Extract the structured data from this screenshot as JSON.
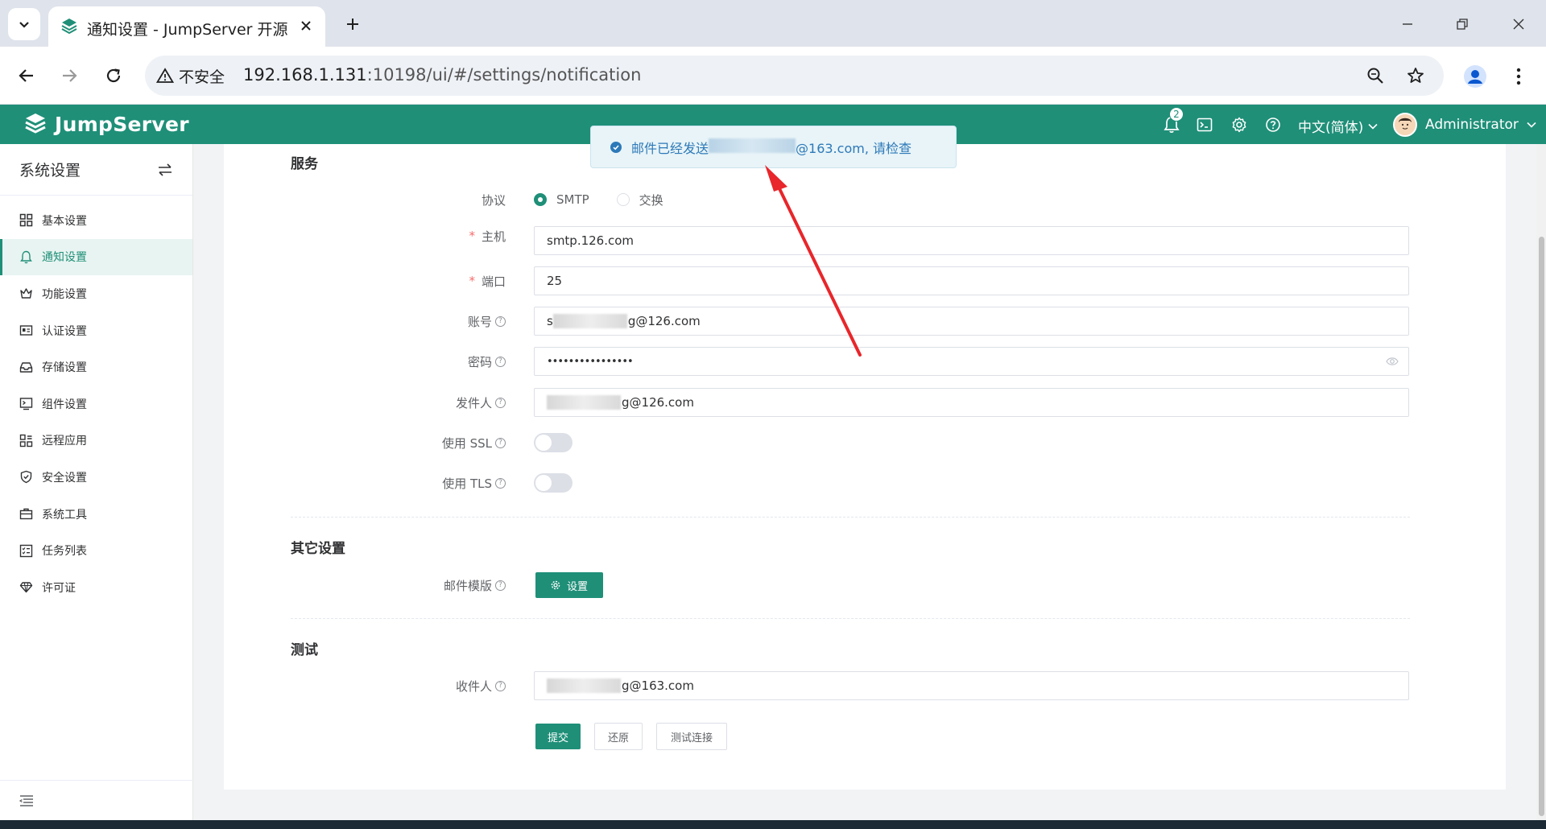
{
  "browser": {
    "tab_title": "通知设置 - JumpServer 开源堡",
    "security_label": "不安全",
    "url_host": "192.168.1.131",
    "url_rest": ":10198/ui/#/settings/notification"
  },
  "header": {
    "logo_text": "JumpServer",
    "notification_count": "2",
    "language": "中文(简体)",
    "user_name": "Administrator"
  },
  "sidebar": {
    "title": "系统设置",
    "items": [
      {
        "label": "基本设置",
        "icon": "grid-icon"
      },
      {
        "label": "通知设置",
        "icon": "bell-icon"
      },
      {
        "label": "功能设置",
        "icon": "crown-icon"
      },
      {
        "label": "认证设置",
        "icon": "id-card-icon"
      },
      {
        "label": "存储设置",
        "icon": "inbox-icon"
      },
      {
        "label": "组件设置",
        "icon": "terminal-icon"
      },
      {
        "label": "远程应用",
        "icon": "apps-icon"
      },
      {
        "label": "安全设置",
        "icon": "shield-icon"
      },
      {
        "label": "系统工具",
        "icon": "briefcase-icon"
      },
      {
        "label": "任务列表",
        "icon": "tasks-icon"
      },
      {
        "label": "许可证",
        "icon": "diamond-icon"
      }
    ]
  },
  "toast": {
    "prefix": "邮件已经发送",
    "suffix": "@163.com, 请检查"
  },
  "form": {
    "service_title": "服务",
    "protocol_label": "协议",
    "protocol_options": [
      "SMTP",
      "交换"
    ],
    "host_label": "主机",
    "host_value": "smtp.126.com",
    "port_label": "端口",
    "port_value": "25",
    "account_label": "账号",
    "account_prefix": "s",
    "account_suffix": "g@126.com",
    "password_label": "密码",
    "password_value": "••••••••••••••••",
    "sender_label": "发件人",
    "sender_suffix": "g@126.com",
    "ssl_label": "使用 SSL",
    "tls_label": "使用 TLS",
    "other_title": "其它设置",
    "template_label": "邮件模版",
    "template_button": "设置",
    "test_title": "测试",
    "recipient_label": "收件人",
    "recipient_suffix": "g@163.com",
    "submit_button": "提交",
    "reset_button": "还原",
    "test_button": "测试连接"
  },
  "colors": {
    "brand": "#1f8f78",
    "toast_text": "#2d79b8",
    "arrow": "#e8262b"
  }
}
